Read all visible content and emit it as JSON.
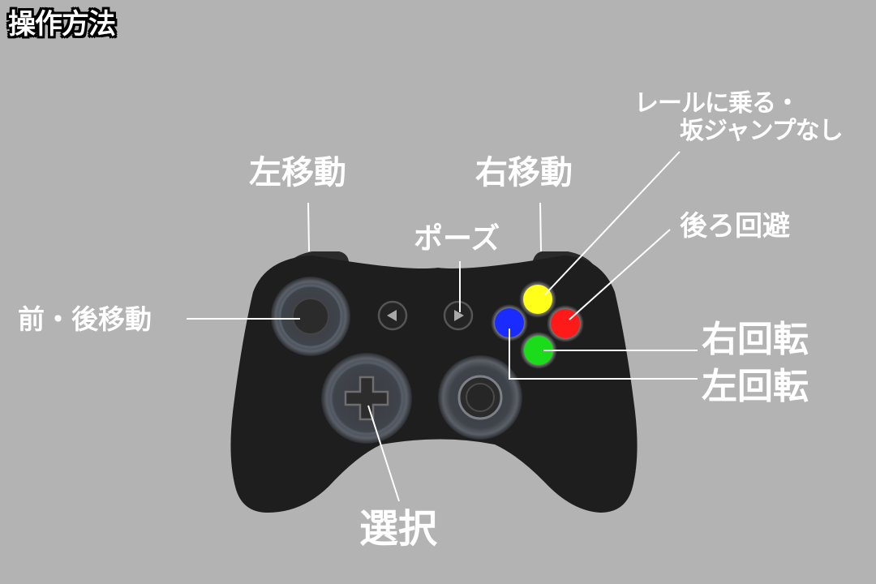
{
  "screen": {
    "title": "操作方法"
  },
  "controls": {
    "left_bumper": "左移動",
    "right_bumper": "右移動",
    "pause": "ポーズ",
    "left_stick": "前・後移動",
    "rail_line1": "レールに乗る・",
    "rail_line2": "坂ジャンプなし",
    "back_dodge": "後ろ回避",
    "rotate_right": "右回転",
    "rotate_left": "左回転",
    "select": "選択"
  },
  "colors": {
    "background": "#b3b3b3",
    "controller": "#1e1e1e",
    "button_top": "#ffff1a",
    "button_right": "#ff1a1a",
    "button_bottom": "#1adc1a",
    "button_left": "#1a2bff",
    "leader_line": "#ffffff"
  },
  "icons": {
    "controller": "gamepad-icon",
    "back_button": "triangle-left-icon",
    "start_button": "triangle-right-icon",
    "dpad": "dpad-icon"
  }
}
